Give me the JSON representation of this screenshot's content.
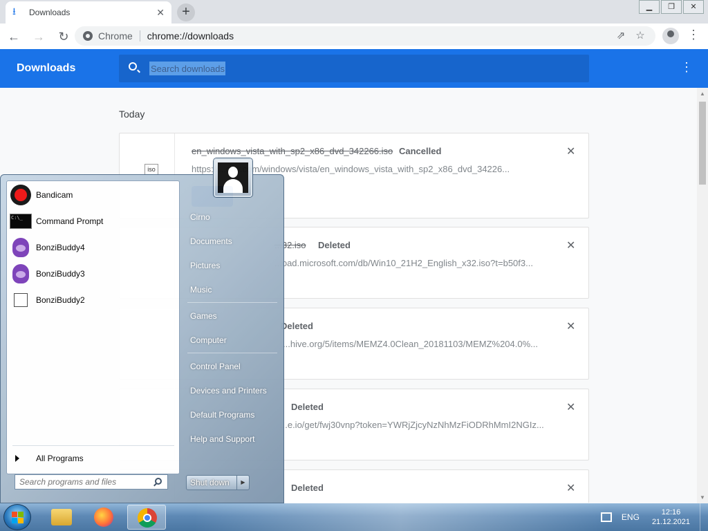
{
  "browser": {
    "tab_title": "Downloads",
    "site_name": "Chrome",
    "url": "chrome://downloads"
  },
  "downloads": {
    "header_title": "Downloads",
    "search_placeholder": "Search downloads",
    "date_label": "Today",
    "items": [
      {
        "file_name": "en_windows_vista_with_sp2_x86_dvd_342266.iso",
        "status": "Cancelled",
        "url": "https://...ony.com/windows/vista/en_windows_vista_with_sp2_x86_dvd_34226...",
        "icon_text": "iso"
      },
      {
        "file_name": "...32.iso",
        "status": "Deleted",
        "url": "...oad.microsoft.com/db/Win10_21H2_English_x32.iso?t=b50f3..."
      },
      {
        "file_name": "",
        "status": "Deleted",
        "url": "...hive.org/5/items/MEMZ4.0Clean_20181103/MEMZ%204.0%..."
      },
      {
        "file_name": "",
        "status": "Deleted",
        "url": "...e.io/get/fwj30vnp?token=YWRjZjcyNzNhMzFiODRhMmI2NGIz..."
      },
      {
        "file_name": "",
        "status": "Deleted",
        "url": ""
      }
    ]
  },
  "start_menu": {
    "programs": [
      {
        "label": "Bandicam",
        "icon": "bandicam-icon"
      },
      {
        "label": "Command Prompt",
        "icon": "command-prompt-icon"
      },
      {
        "label": "BonziBuddy4",
        "icon": "bonzibuddy-icon"
      },
      {
        "label": "BonziBuddy3",
        "icon": "bonzibuddy-icon"
      },
      {
        "label": "BonziBuddy2",
        "icon": "file-icon"
      }
    ],
    "all_programs": "All Programs",
    "search_placeholder": "Search programs and files",
    "right_items": {
      "user": "Cirno",
      "documents": "Documents",
      "pictures": "Pictures",
      "music": "Music",
      "games": "Games",
      "computer": "Computer",
      "control_panel": "Control Panel",
      "devices": "Devices and Printers",
      "default_programs": "Default Programs",
      "help": "Help and Support"
    },
    "shutdown": "Shut down"
  },
  "taskbar": {
    "language": "ENG",
    "time": "12:16",
    "date": "21.12.2021"
  },
  "colors": {
    "chrome_blue": "#1a73e8",
    "taskbar": "#5e89b5"
  }
}
